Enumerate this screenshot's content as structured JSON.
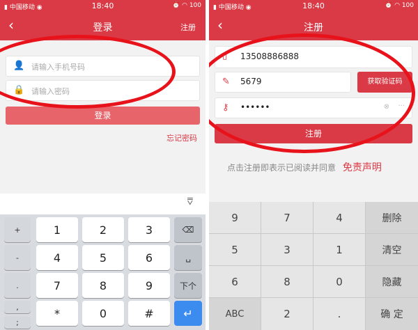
{
  "left": {
    "statusbar": {
      "carrier": "中国移动",
      "time": "18:40",
      "battery": "100"
    },
    "navbar": {
      "back_icon": "chevron-left",
      "title": "登录",
      "action": "注册"
    },
    "phone_field": {
      "placeholder": "请输入手机号码",
      "icon": "user-icon"
    },
    "password_field": {
      "placeholder": "请输入密码",
      "icon": "lock-icon"
    },
    "login_button": "登录",
    "forgot_link": "忘记密码",
    "keyboard": {
      "collapse_icon": "chevron-down-icon",
      "side_keys": [
        "+",
        "-",
        ".",
        ",",
        ";"
      ],
      "rows": [
        [
          "1",
          "2",
          "3"
        ],
        [
          "4",
          "5",
          "6"
        ],
        [
          "7",
          "8",
          "9"
        ],
        [
          "*",
          "0",
          "#"
        ]
      ],
      "func_keys": [
        "⌫",
        "␣",
        "下个",
        "↵"
      ]
    }
  },
  "right": {
    "statusbar": {
      "carrier": "中国移动",
      "time": "18:40",
      "battery": "100"
    },
    "navbar": {
      "back_icon": "chevron-left",
      "title": "注册"
    },
    "phone_field": {
      "value": "13508886888",
      "icon": "phone-icon"
    },
    "code_field": {
      "value": "5679",
      "icon": "pencil-icon"
    },
    "code_button": "获取验证码",
    "password_field": {
      "value": "••••••",
      "icon": "key-icon"
    },
    "register_button": "注册",
    "agreement_text": "点击注册即表示已阅读并同意",
    "agreement_link": "免责声明",
    "keyboard": {
      "rows": [
        [
          "9",
          "7",
          "4",
          "删除"
        ],
        [
          "5",
          "3",
          "1",
          "清空"
        ],
        [
          "6",
          "8",
          "0",
          "隐藏"
        ],
        [
          "ABC",
          "2",
          ".",
          "确 定"
        ]
      ]
    }
  },
  "colors": {
    "brand": "#d93a45",
    "annotation": "#e8121b",
    "enter_key": "#3c8cf0"
  }
}
